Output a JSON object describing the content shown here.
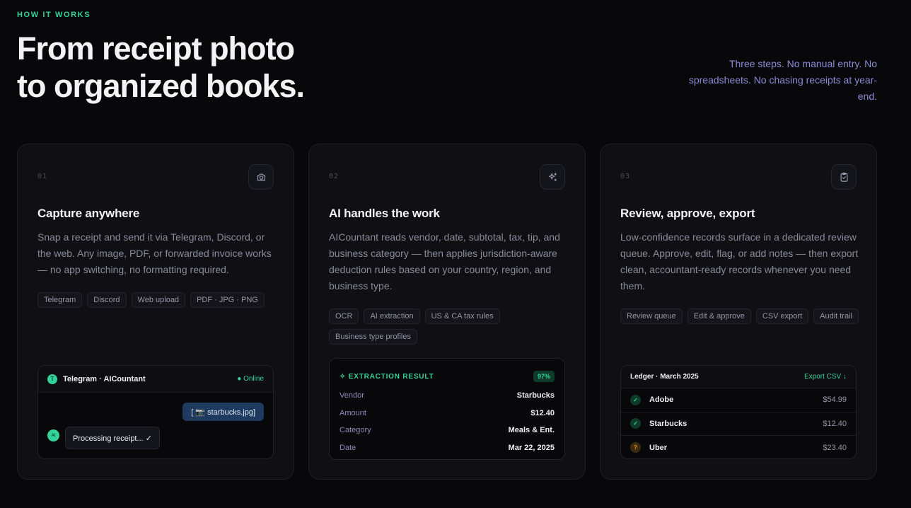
{
  "section": {
    "eyebrow": "HOW IT WORKS",
    "headline_line1": "From receipt photo",
    "headline_line2": "to organized books.",
    "subhead": "Three steps. No manual entry. No spreadsheets. No chasing receipts at year-end."
  },
  "cards": [
    {
      "number": "01",
      "icon": "camera-icon",
      "title": "Capture anywhere",
      "description": "Snap a receipt and send it via Telegram, Discord, or the web. Any image, PDF, or forwarded invoice works — no app switching, no formatting required.",
      "tags": [
        "Telegram",
        "Discord",
        "Web upload",
        "PDF · JPG · PNG"
      ]
    },
    {
      "number": "02",
      "icon": "sparkles-icon",
      "title": "AI handles the work",
      "description": "AICountant reads vendor, date, subtotal, tax, tip, and business category — then applies jurisdiction-aware deduction rules based on your country, region, and business type.",
      "tags": [
        "OCR",
        "AI extraction",
        "US & CA tax rules",
        "Business type profiles"
      ]
    },
    {
      "number": "03",
      "icon": "clipboard-check-icon",
      "title": "Review, approve, export",
      "description": "Low-confidence records surface in a dedicated review queue. Approve, edit, flag, or add notes — then export clean, accountant-ready records whenever you need them.",
      "tags": [
        "Review queue",
        "Edit & approve",
        "CSV export",
        "Audit trail"
      ]
    }
  ],
  "telegram": {
    "avatar": "T",
    "title": "Telegram · AICountant",
    "status": "● Online",
    "outgoing": "[ 📷 starbucks.jpg]",
    "ai_avatar": "AI",
    "incoming": "Processing receipt... ✓"
  },
  "extraction": {
    "label": "✧ EXTRACTION RESULT",
    "confidence": "97%",
    "rows": [
      {
        "key": "Vendor",
        "value": "Starbucks"
      },
      {
        "key": "Amount",
        "value": "$12.40"
      },
      {
        "key": "Category",
        "value": "Meals & Ent."
      },
      {
        "key": "Date",
        "value": "Mar 22, 2025"
      }
    ]
  },
  "ledger": {
    "title": "Ledger · March 2025",
    "export_label": "Export CSV ↓",
    "rows": [
      {
        "status": "✓",
        "vendor": "Adobe",
        "amount": "$54.99"
      },
      {
        "status": "✓",
        "vendor": "Starbucks",
        "amount": "$12.40"
      },
      {
        "status": "?",
        "vendor": "Uber",
        "amount": "$23.40"
      }
    ]
  },
  "colors": {
    "accent": "#34d399",
    "subhead": "#8b8bd6",
    "background": "#08080b"
  }
}
